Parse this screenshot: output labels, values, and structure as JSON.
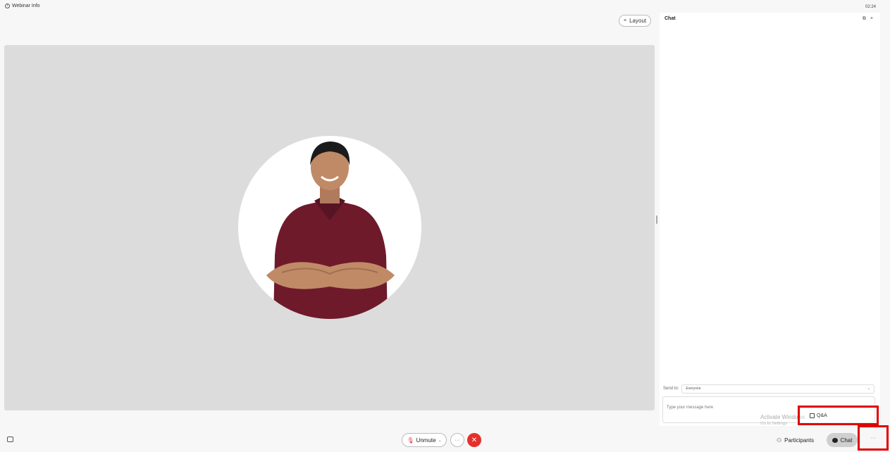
{
  "topbar": {
    "webinar_info": "Webinar Info",
    "clock": "02:24"
  },
  "stage": {
    "layout_label": "Layout"
  },
  "chat": {
    "title": "Chat",
    "send_to_label": "Send to:",
    "send_to_value": "Everyone",
    "message_placeholder": "Type your message here"
  },
  "overlay": {
    "activate_title": "Activate Windows",
    "activate_sub": "Go to Settings",
    "qa_label": "Q&A"
  },
  "bottombar": {
    "unmute_label": "Unmute",
    "participants_label": "Participants",
    "chat_label": "Chat",
    "more_label": "···"
  },
  "colors": {
    "highlight": "#e00000",
    "leave": "#e4322b",
    "shirt": "#6e1a2b"
  }
}
